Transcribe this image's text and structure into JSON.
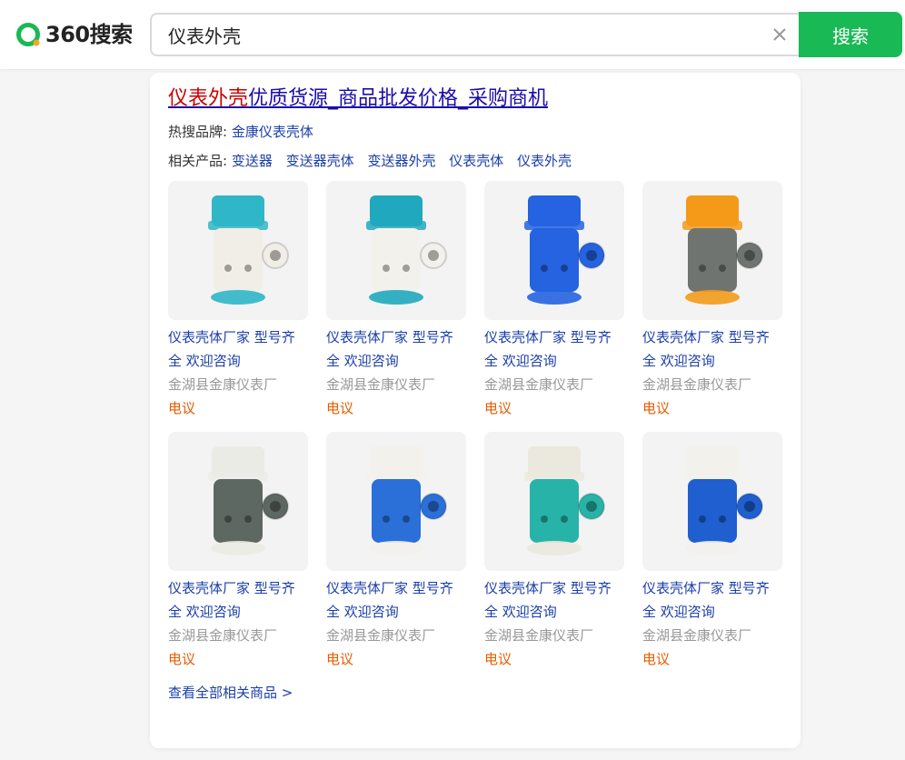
{
  "header": {
    "logo_text": "360搜索",
    "search_value": "仪表外壳",
    "search_button": "搜索"
  },
  "result": {
    "title_highlight": "仪表外壳",
    "title_rest": "优质货源_商品批发价格_采购商机",
    "hot_brands_label": "热搜品牌:",
    "hot_brands": [
      "金康仪表壳体"
    ],
    "related_label": "相关产品:",
    "related_products": [
      "变送器",
      "变送器壳体",
      "变送器外壳",
      "仪表壳体",
      "仪表外壳"
    ],
    "products": [
      {
        "title": "仪表壳体厂家 型号齐全 欢迎咨询",
        "company": "金湖县金康仪表厂",
        "price": "电议",
        "top_color": "#2fb6c7",
        "body_color": "#f0eee6"
      },
      {
        "title": "仪表壳体厂家 型号齐全 欢迎咨询",
        "company": "金湖县金康仪表厂",
        "price": "电议",
        "top_color": "#20a9be",
        "body_color": "#f2f1ec"
      },
      {
        "title": "仪表壳体厂家 型号齐全 欢迎咨询",
        "company": "金湖县金康仪表厂",
        "price": "电议",
        "top_color": "#2563e0",
        "body_color": "#2563e0"
      },
      {
        "title": "仪表壳体厂家 型号齐全 欢迎咨询",
        "company": "金湖县金康仪表厂",
        "price": "电议",
        "top_color": "#f39a19",
        "body_color": "#6f7470"
      },
      {
        "title": "仪表壳体厂家 型号齐全 欢迎咨询",
        "company": "金湖县金康仪表厂",
        "price": "电议",
        "top_color": "#ebebe6",
        "body_color": "#5e6862"
      },
      {
        "title": "仪表壳体厂家 型号齐全 欢迎咨询",
        "company": "金湖县金康仪表厂",
        "price": "电议",
        "top_color": "#f2f1ec",
        "body_color": "#2b6fd8"
      },
      {
        "title": "仪表壳体厂家 型号齐全 欢迎咨询",
        "company": "金湖县金康仪表厂",
        "price": "电议",
        "top_color": "#ebe8de",
        "body_color": "#28b3a8"
      },
      {
        "title": "仪表壳体厂家 型号齐全 欢迎咨询",
        "company": "金湖县金康仪表厂",
        "price": "电议",
        "top_color": "#f2f1ec",
        "body_color": "#1f5fcf"
      }
    ],
    "view_all": "查看全部相关商品 >"
  },
  "colors": {
    "accent_green": "#19b955",
    "link_blue": "#1a3ea9",
    "highlight_red": "#cc0000",
    "price_orange": "#e65c00"
  }
}
